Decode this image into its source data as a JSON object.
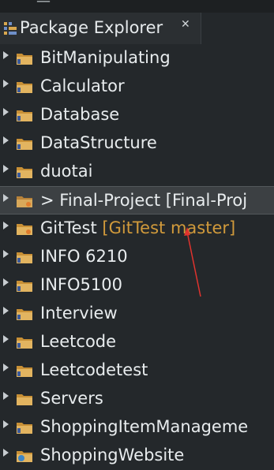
{
  "view": {
    "title": "Package Explorer",
    "close_glyph": "✕",
    "top_strip_text": "— ˇ"
  },
  "projects": [
    {
      "name": "BitManipulating",
      "icon": "java-project-folder-icon"
    },
    {
      "name": "Calculator",
      "icon": "java-project-folder-icon"
    },
    {
      "name": "Database",
      "icon": "java-project-folder-icon"
    },
    {
      "name": "DataStructure",
      "icon": "java-project-folder-icon"
    },
    {
      "name": "duotai",
      "icon": "java-project-folder-icon"
    },
    {
      "name": "> Final-Project [Final-Proj",
      "icon": "git-project-folder-icon",
      "selected": true
    },
    {
      "name": "GitTest",
      "git_label": "[GitTest master]",
      "icon": "git-project-folder-icon"
    },
    {
      "name": "INFO 6210",
      "icon": "java-project-folder-icon"
    },
    {
      "name": "INFO5100",
      "icon": "java-project-folder-icon"
    },
    {
      "name": "Interview",
      "icon": "java-project-folder-icon"
    },
    {
      "name": "Leetcode",
      "icon": "java-project-folder-icon"
    },
    {
      "name": "Leetcodetest",
      "icon": "java-project-folder-icon"
    },
    {
      "name": "Servers",
      "icon": "folder-icon"
    },
    {
      "name": "ShoppingItemManageme",
      "icon": "java-project-folder-icon"
    },
    {
      "name": "ShoppingWebsite",
      "icon": "web-project-folder-icon"
    }
  ],
  "colors": {
    "background": "#24282b",
    "text": "#e8ecee",
    "git_decoration": "#d19a3b",
    "folder": "#d9a84f",
    "annotation_arrow": "#e0332e"
  }
}
